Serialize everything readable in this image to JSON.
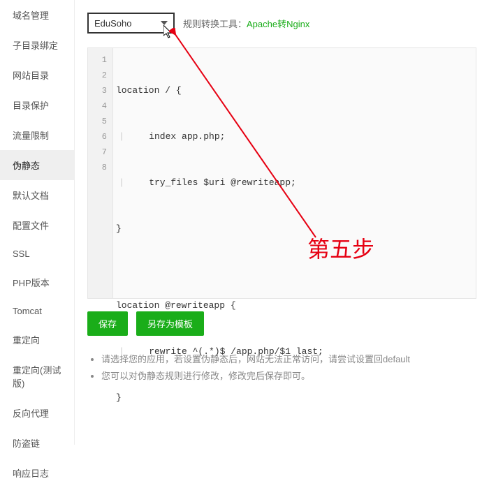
{
  "sidebar": {
    "items": [
      {
        "label": "域名管理"
      },
      {
        "label": "子目录绑定"
      },
      {
        "label": "网站目录"
      },
      {
        "label": "目录保护"
      },
      {
        "label": "流量限制"
      },
      {
        "label": "伪静态"
      },
      {
        "label": "默认文档"
      },
      {
        "label": "配置文件"
      },
      {
        "label": "SSL"
      },
      {
        "label": "PHP版本"
      },
      {
        "label": "Tomcat"
      },
      {
        "label": "重定向"
      },
      {
        "label": "重定向(测试版)"
      },
      {
        "label": "反向代理"
      },
      {
        "label": "防盗链"
      },
      {
        "label": "响应日志"
      }
    ],
    "activeIndex": 5
  },
  "top": {
    "selected": "EduSoho",
    "convertLabel": "规则转换工具：",
    "convertLink": "Apache转Nginx"
  },
  "code": {
    "lines": [
      "location / {",
      "    index app.php;",
      "    try_files $uri @rewriteapp;",
      "}",
      "",
      "location @rewriteapp {",
      "    rewrite ^(.*)$ /app.php/$1 last;",
      "}"
    ]
  },
  "buttons": {
    "save": "保存",
    "saveAs": "另存为模板"
  },
  "notes": {
    "items": [
      "请选择您的应用，若设置伪静态后，网站无法正常访问，请尝试设置回default",
      "您可以对伪静态规则进行修改，修改完后保存即可。"
    ]
  },
  "annotation": {
    "text": "第五步"
  }
}
